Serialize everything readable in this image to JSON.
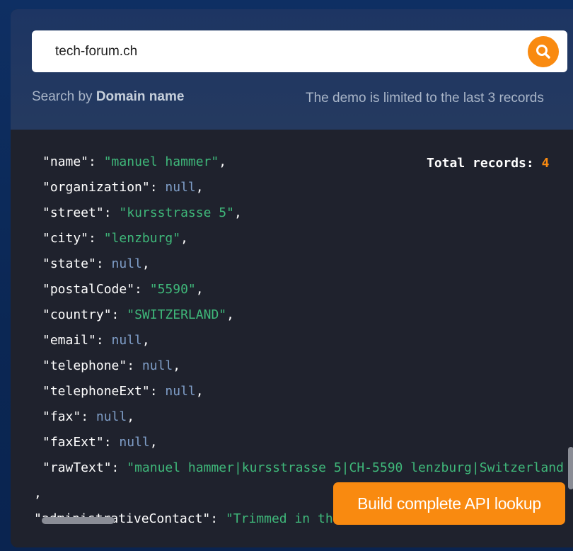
{
  "search": {
    "value": "tech-forum.ch",
    "hint_prefix": "Search by ",
    "hint_mode": "Domain name",
    "limit_note": "The demo is limited to the last 3 records"
  },
  "results": {
    "total_label": "Total records: ",
    "total_count": "4",
    "lines": [
      {
        "key": "\"name\"",
        "value": "\"manuel hammer\"",
        "type": "string",
        "suffix": ","
      },
      {
        "key": "\"organization\"",
        "value": "null",
        "type": "null",
        "suffix": ","
      },
      {
        "key": "\"street\"",
        "value": "\"kursstrasse 5\"",
        "type": "string",
        "suffix": ","
      },
      {
        "key": "\"city\"",
        "value": "\"lenzburg\"",
        "type": "string",
        "suffix": ","
      },
      {
        "key": "\"state\"",
        "value": "null",
        "type": "null",
        "suffix": ","
      },
      {
        "key": "\"postalCode\"",
        "value": "\"5590\"",
        "type": "string",
        "suffix": ","
      },
      {
        "key": "\"country\"",
        "value": "\"SWITZERLAND\"",
        "type": "string",
        "suffix": ","
      },
      {
        "key": "\"email\"",
        "value": "null",
        "type": "null",
        "suffix": ","
      },
      {
        "key": "\"telephone\"",
        "value": "null",
        "type": "null",
        "suffix": ","
      },
      {
        "key": "\"telephoneExt\"",
        "value": "null",
        "type": "null",
        "suffix": ","
      },
      {
        "key": "\"fax\"",
        "value": "null",
        "type": "null",
        "suffix": ","
      },
      {
        "key": "\"faxExt\"",
        "value": "null",
        "type": "null",
        "suffix": ","
      },
      {
        "key": "\"rawText\"",
        "value": "\"manuel hammer|kursstrasse 5|CH-5590 lenzburg|Switzerland",
        "type": "string",
        "suffix": ""
      }
    ],
    "closing_comma": ",",
    "next_key": "\"administrativeContact\"",
    "next_value": "\"Trimmed in the demo\""
  },
  "cta": {
    "label": "Build complete API lookup"
  },
  "colors": {
    "accent": "#f98a10",
    "string": "#3fb87a",
    "null": "#7f9ec8",
    "panel": "#1f222d"
  },
  "icons": {
    "search": "search-icon"
  }
}
